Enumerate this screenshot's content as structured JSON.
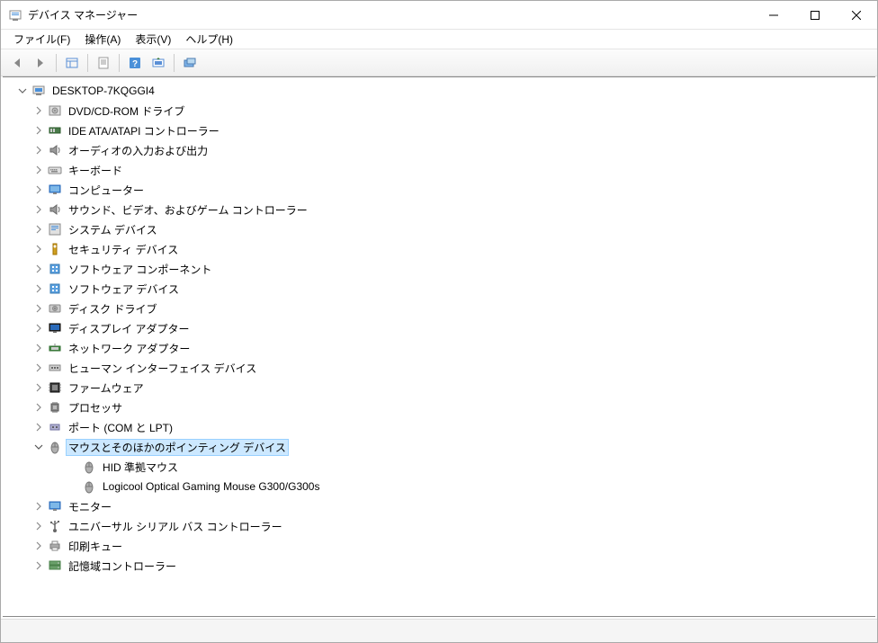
{
  "window": {
    "title": "デバイス マネージャー"
  },
  "menu": {
    "file": "ファイル(F)",
    "action": "操作(A)",
    "view": "表示(V)",
    "help": "ヘルプ(H)"
  },
  "root": {
    "label": "DESKTOP-7KQGGI4"
  },
  "categories": [
    {
      "id": "dvd",
      "label": "DVD/CD-ROM ドライブ",
      "icon": "disc"
    },
    {
      "id": "ide",
      "label": "IDE ATA/ATAPI コントローラー",
      "icon": "ide"
    },
    {
      "id": "audio-io",
      "label": "オーディオの入力および出力",
      "icon": "speaker"
    },
    {
      "id": "keyboard",
      "label": "キーボード",
      "icon": "keyboard"
    },
    {
      "id": "computer",
      "label": "コンピューター",
      "icon": "monitor"
    },
    {
      "id": "sound-video",
      "label": "サウンド、ビデオ、およびゲーム コントローラー",
      "icon": "speaker"
    },
    {
      "id": "system",
      "label": "システム デバイス",
      "icon": "system"
    },
    {
      "id": "security",
      "label": "セキュリティ デバイス",
      "icon": "security"
    },
    {
      "id": "software-component",
      "label": "ソフトウェア コンポーネント",
      "icon": "software"
    },
    {
      "id": "software-device",
      "label": "ソフトウェア デバイス",
      "icon": "software"
    },
    {
      "id": "disk",
      "label": "ディスク ドライブ",
      "icon": "disk"
    },
    {
      "id": "display",
      "label": "ディスプレイ アダプター",
      "icon": "display"
    },
    {
      "id": "network",
      "label": "ネットワーク アダプター",
      "icon": "network"
    },
    {
      "id": "hid",
      "label": "ヒューマン インターフェイス デバイス",
      "icon": "hid"
    },
    {
      "id": "firmware",
      "label": "ファームウェア",
      "icon": "firmware"
    },
    {
      "id": "processor",
      "label": "プロセッサ",
      "icon": "cpu"
    },
    {
      "id": "ports",
      "label": "ポート (COM と LPT)",
      "icon": "port"
    },
    {
      "id": "mouse",
      "label": "マウスとそのほかのポインティング デバイス",
      "icon": "mouse",
      "expanded": true,
      "selected": true,
      "children": [
        {
          "label": "HID 準拠マウス",
          "icon": "mouse"
        },
        {
          "label": "Logicool Optical Gaming Mouse G300/G300s",
          "icon": "mouse"
        }
      ]
    },
    {
      "id": "monitor",
      "label": "モニター",
      "icon": "monitor"
    },
    {
      "id": "usb",
      "label": "ユニバーサル シリアル バス コントローラー",
      "icon": "usb"
    },
    {
      "id": "print-queue",
      "label": "印刷キュー",
      "icon": "printer"
    },
    {
      "id": "storage",
      "label": "記憶域コントローラー",
      "icon": "storage"
    }
  ]
}
